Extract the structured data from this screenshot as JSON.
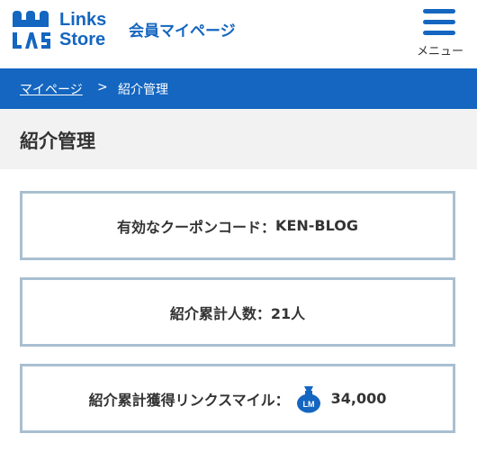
{
  "header": {
    "logo_line1": "Links",
    "logo_line2": "Store",
    "subtitle": "会員マイページ",
    "menu_label": "メニュー",
    "brand_color": "#1466c0"
  },
  "breadcrumb": {
    "home": "マイページ",
    "separator": ">",
    "current": "紹介管理"
  },
  "page": {
    "title": "紹介管理"
  },
  "cards": {
    "coupon_label": "有効なクーポンコード：",
    "coupon_value": "KEN-BLOG",
    "referrals_label": "紹介累計人数：",
    "referrals_value": "21人",
    "miles_label": "紹介累計獲得リンクスマイル：",
    "miles_icon": "money-bag-icon",
    "miles_icon_text": "LM",
    "miles_value": "34,000"
  }
}
